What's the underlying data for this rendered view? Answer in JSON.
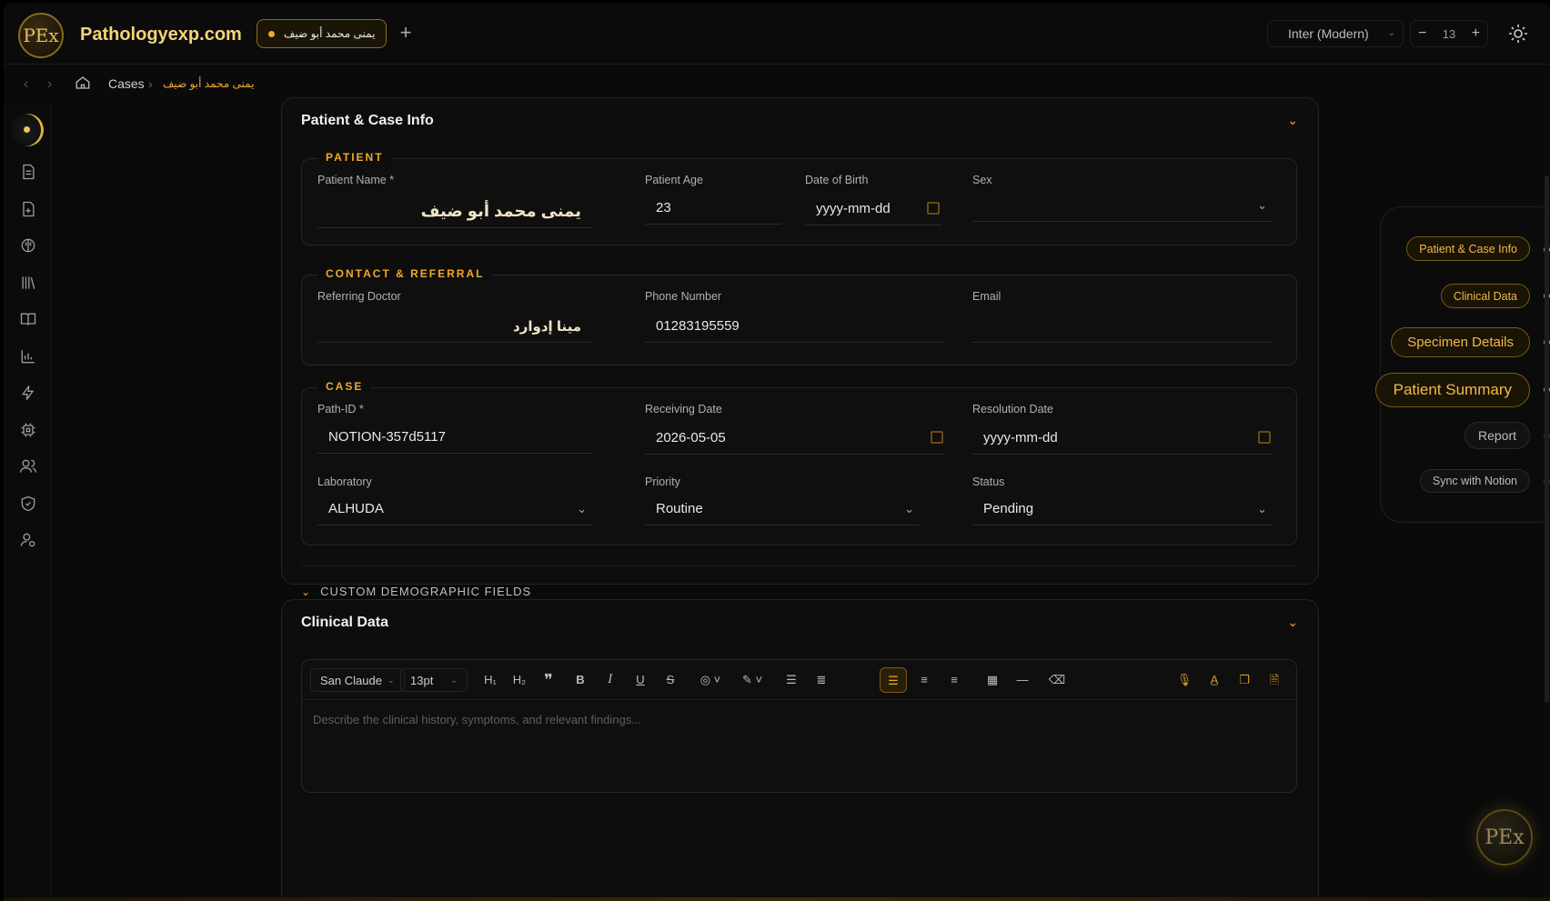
{
  "app": {
    "brand": "Pathologyexp.com",
    "logo_text": "PEx"
  },
  "tabs": [
    {
      "label": "يمنى محمد أبو ضيف"
    }
  ],
  "font_selector": {
    "value": "Inter (Modern)"
  },
  "zoom": {
    "value": "13",
    "minus": "−",
    "plus": "+"
  },
  "breadcrumb": {
    "cases": "Cases",
    "current": "يمنى محمد أبو ضيف"
  },
  "patient_card": {
    "title": "Patient & Case Info",
    "patient": {
      "legend": "PATIENT",
      "name_label": "Patient Name *",
      "name_value": "يمنى محمد أبو ضيف",
      "age_label": "Patient Age",
      "age_value": "23",
      "dob_label": "Date of Birth",
      "dob_value": "yyyy-mm-dd",
      "sex_label": "Sex",
      "sex_value": ""
    },
    "contact": {
      "legend": "CONTACT & REFERRAL",
      "doctor_label": "Referring Doctor",
      "doctor_value": "مينا إدوارد",
      "phone_label": "Phone Number",
      "phone_value": "01283195559",
      "email_label": "Email",
      "email_value": ""
    },
    "case": {
      "legend": "CASE",
      "path_label": "Path-ID *",
      "path_value": "NOTION-357d5117",
      "receiving_label": "Receiving Date",
      "receiving_value": "2026-05-05",
      "resolution_label": "Resolution Date",
      "resolution_value": "yyyy-mm-dd",
      "lab_label": "Laboratory",
      "lab_value": "ALHUDA",
      "priority_label": "Priority",
      "priority_value": "Routine",
      "status_label": "Status",
      "status_value": "Pending"
    },
    "custom_fields": "CUSTOM DEMOGRAPHIC FIELDS"
  },
  "clinical_card": {
    "title": "Clinical Data",
    "toolbar": {
      "font": "San Claude",
      "size": "13pt",
      "h1": "H₁",
      "h2": "H₂"
    },
    "placeholder": "Describe the clinical history, symptoms, and relevant findings..."
  },
  "section_nav": [
    {
      "label": "Patient & Case Info",
      "state": "active"
    },
    {
      "label": "Clinical Data",
      "state": "active"
    },
    {
      "label": "Specimen Details",
      "state": "active"
    },
    {
      "label": "Patient Summary",
      "state": "active"
    },
    {
      "label": "Report",
      "state": "inactive"
    },
    {
      "label": "Sync with Notion",
      "state": "inactive"
    }
  ],
  "colors": {
    "accent": "#f2a72e",
    "brand": "#f4d37a",
    "background": "#0a0a0a"
  }
}
